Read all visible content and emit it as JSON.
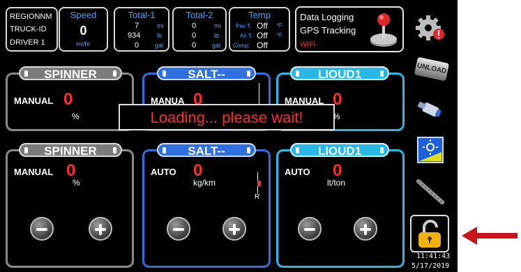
{
  "header": {
    "ids": {
      "line1": "REGIONNM",
      "line2": "TRUCK-ID",
      "line3": "DRIVER 1"
    },
    "speed": {
      "title": "Speed",
      "value": "0",
      "unit": "mi/hr"
    },
    "total1": {
      "title": "Total-1",
      "rows": [
        {
          "v": "7",
          "u": "mi"
        },
        {
          "v": "934",
          "u": "lb"
        },
        {
          "v": "0",
          "u": "gal"
        }
      ]
    },
    "total2": {
      "title": "Total-2",
      "rows": [
        {
          "v": "0",
          "u": "mi"
        },
        {
          "v": "0",
          "u": "lb"
        },
        {
          "v": "0",
          "u": "gal"
        }
      ]
    },
    "temp": {
      "title": "Temp",
      "rows": [
        {
          "k": "Pav T:",
          "v": "Off",
          "u": "ºF"
        },
        {
          "k": "Air T:",
          "v": "Off",
          "u": "ºF"
        },
        {
          "k": "Comp:",
          "v": "Off",
          "u": ""
        }
      ]
    },
    "status": {
      "logging": "Data Logging",
      "gps": "GPS Tracking",
      "wifi": "WiFi"
    }
  },
  "panels_top": [
    {
      "title": "SPINNER",
      "mode": "MANUAL",
      "value": "0",
      "unit": "%",
      "color": "#8a8a8a"
    },
    {
      "title": "SALT--",
      "mode": "MANUA",
      "value": "0",
      "unit": "",
      "color": "#2f6fe0"
    },
    {
      "title": "LIOUD1",
      "mode": "MANUAL",
      "value": "0",
      "unit": "%",
      "color": "#27b8e8"
    }
  ],
  "panels_bottom": [
    {
      "title": "SPINNER",
      "mode": "MANUAL",
      "value": "0",
      "unit": "%",
      "color": "#8a8a8a"
    },
    {
      "title": "SALT--",
      "mode": "AUTO",
      "value": "0",
      "unit": "kg/km",
      "color": "#2f6fe0",
      "gauge_mark": "R"
    },
    {
      "title": "LIOUD1",
      "mode": "AUTO",
      "value": "0",
      "unit": "lt/ton",
      "color": "#27b8e8"
    }
  ],
  "loading": "Loading... please wait!",
  "sidebar": {
    "unload_label": "UNLOAD",
    "time": "11:41:43",
    "date": "5/17/2019"
  },
  "colors": {
    "accent_red": "#ff2a2a",
    "arrow": "#c8171b"
  },
  "icons": [
    "gear-alert-icon",
    "unload-icon",
    "usb-icon",
    "brightness-icon",
    "auger-icon",
    "unlock-icon",
    "arrow-left-icon"
  ]
}
